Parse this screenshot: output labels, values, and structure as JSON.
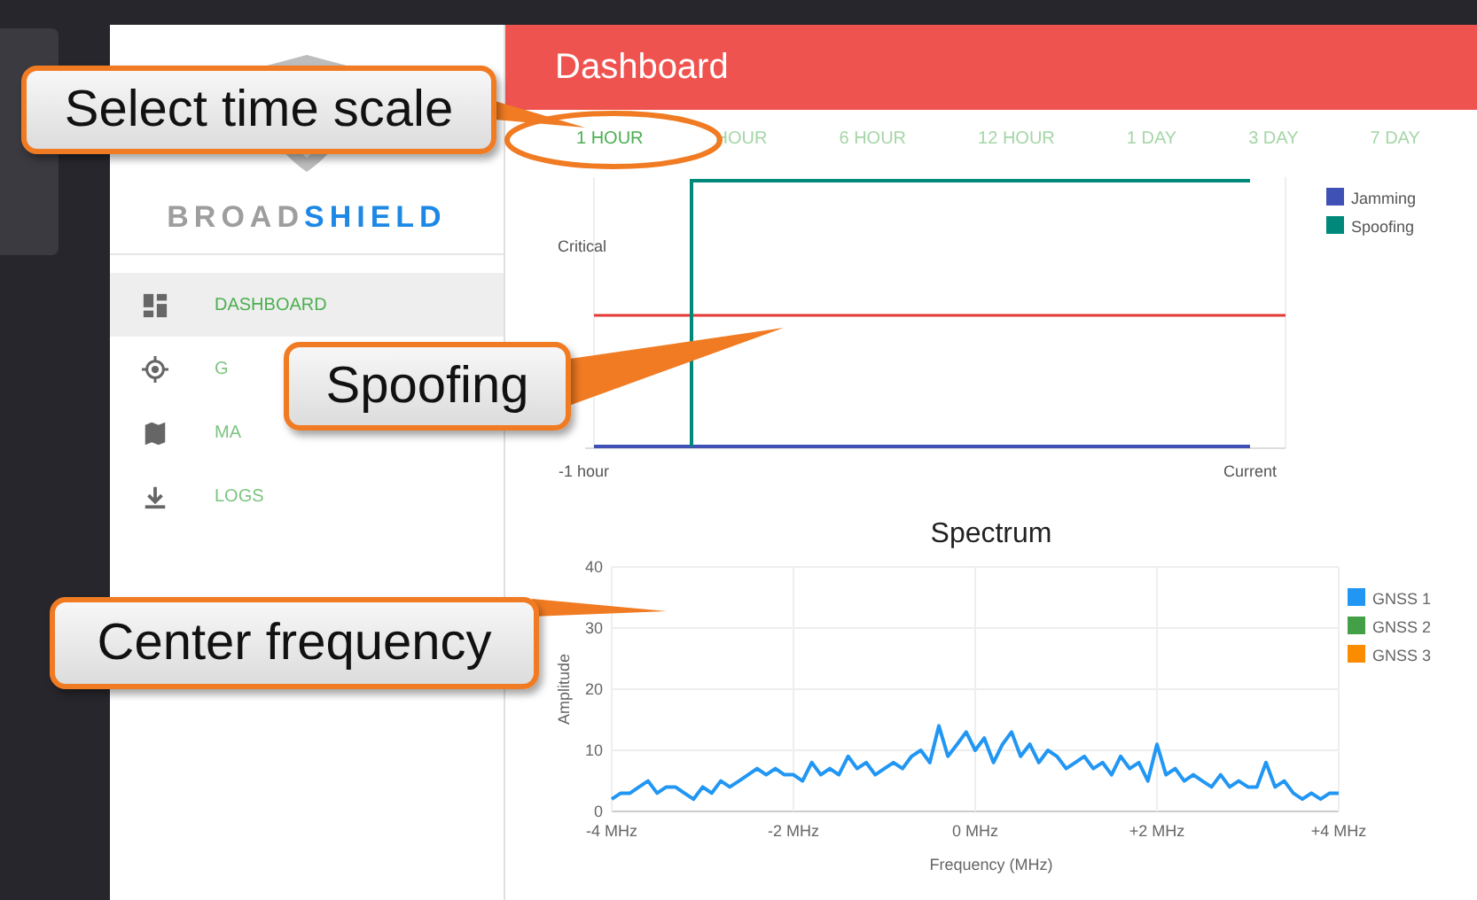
{
  "sidebar": {
    "logo": "BROAD**SHIELD**",
    "items": [
      {
        "kind": "dashboard",
        "label": "DASHBOARD",
        "selected": true
      },
      {
        "kind": "target",
        "label": "G",
        "selected": false
      },
      {
        "kind": "map",
        "label": "MA",
        "selected": false
      },
      {
        "kind": "download",
        "label": "LOGS",
        "selected": false
      }
    ]
  },
  "header": {
    "title": "Dashboard"
  },
  "tabs": [
    {
      "label": "1 HOUR",
      "selected": true
    },
    {
      "label": "HOUR",
      "selected": false
    },
    {
      "label": "6 HOUR",
      "selected": false
    },
    {
      "label": "12 HOUR",
      "selected": false
    },
    {
      "label": "1 DAY",
      "selected": false
    },
    {
      "label": "3 DAY",
      "selected": false
    },
    {
      "label": "7 DAY",
      "selected": false
    }
  ],
  "status_chart": {
    "y_label": "Critical",
    "x_start": "-1 hour",
    "x_end": "Current",
    "legend": [
      {
        "name": "Jamming",
        "color": "#3f51b5"
      },
      {
        "name": "Spoofing",
        "color": "#00897b"
      }
    ]
  },
  "spectrum": {
    "chart_data": {
      "type": "line",
      "grid": true,
      "title": "Spectrum",
      "xlabel": "Frequency (MHz)",
      "ylabel": "Amplitude",
      "xlim": [
        -4,
        4
      ],
      "ylim": [
        0,
        40
      ],
      "xticks": [
        {
          "value": -4,
          "label": "-4 MHz"
        },
        {
          "value": -2,
          "label": "-2 MHz"
        },
        {
          "value": 0,
          "label": "0 MHz"
        },
        {
          "value": 2,
          "label": "+2 MHz"
        },
        {
          "value": 4,
          "label": "+4 MHz"
        }
      ],
      "yticks": [
        0,
        10,
        20,
        30,
        40
      ],
      "x": [
        -4,
        -3.9,
        -3.8,
        -3.7,
        -3.6,
        -3.5,
        -3.4,
        -3.3,
        -3.2,
        -3.1,
        -3,
        -2.9,
        -2.8,
        -2.7,
        -2.6,
        -2.5,
        -2.4,
        -2.3,
        -2.2,
        -2.1,
        -2,
        -1.9,
        -1.8,
        -1.7,
        -1.6,
        -1.5,
        -1.4,
        -1.3,
        -1.2,
        -1.1,
        -1,
        -0.9,
        -0.8,
        -0.7,
        -0.6,
        -0.5,
        -0.4,
        -0.3,
        -0.2,
        -0.1,
        0,
        0.1,
        0.2,
        0.3,
        0.4,
        0.5,
        0.6,
        0.7,
        0.8,
        0.9,
        1,
        1.1,
        1.2,
        1.3,
        1.4,
        1.5,
        1.6,
        1.7,
        1.8,
        1.9,
        2,
        2.1,
        2.2,
        2.3,
        2.4,
        2.5,
        2.6,
        2.7,
        2.8,
        2.9,
        3,
        3.1,
        3.2,
        3.3,
        3.4,
        3.5,
        3.6,
        3.7,
        3.8,
        3.9,
        4
      ],
      "series": [
        {
          "name": "GNSS 1",
          "color": "#2196f3",
          "values": [
            2,
            3,
            3,
            4,
            5,
            3,
            4,
            4,
            3,
            2,
            4,
            3,
            5,
            4,
            5,
            6,
            7,
            6,
            7,
            6,
            6,
            5,
            8,
            6,
            7,
            6,
            9,
            7,
            8,
            6,
            7,
            8,
            7,
            9,
            10,
            8,
            14,
            9,
            11,
            13,
            10,
            12,
            8,
            11,
            13,
            9,
            11,
            8,
            10,
            9,
            7,
            8,
            9,
            7,
            8,
            6,
            9,
            7,
            8,
            5,
            11,
            6,
            7,
            5,
            6,
            5,
            4,
            6,
            4,
            5,
            4,
            4,
            8,
            4,
            5,
            3,
            2,
            3,
            2,
            3,
            3
          ]
        },
        {
          "name": "GNSS 2",
          "color": "#43a047",
          "values": [
            null,
            null,
            null,
            null,
            null,
            null,
            null,
            null,
            null,
            null,
            null,
            null,
            null,
            null,
            null,
            null,
            null,
            null,
            null,
            null,
            null,
            null,
            null,
            null,
            null,
            null,
            null,
            null,
            null,
            null,
            null,
            null,
            null,
            null,
            null,
            null,
            null,
            null,
            null,
            null,
            null,
            null,
            null,
            null,
            null,
            null,
            null,
            null,
            null,
            null,
            null,
            null,
            null,
            null,
            null,
            null,
            null,
            null,
            null,
            null,
            null,
            null,
            null,
            null,
            null,
            null,
            null,
            null,
            null,
            null,
            null,
            null,
            null,
            null,
            null,
            null,
            null,
            null,
            null,
            null,
            null
          ]
        },
        {
          "name": "GNSS 3",
          "color": "#fb8c00",
          "values": [
            null,
            null,
            null,
            null,
            null,
            null,
            null,
            null,
            null,
            null,
            null,
            null,
            null,
            null,
            null,
            null,
            null,
            null,
            null,
            null,
            null,
            null,
            null,
            null,
            null,
            null,
            null,
            null,
            null,
            null,
            null,
            null,
            null,
            null,
            null,
            null,
            null,
            null,
            null,
            null,
            null,
            null,
            null,
            null,
            null,
            null,
            null,
            null,
            null,
            null,
            null,
            null,
            null,
            null,
            null,
            null,
            null,
            null,
            null,
            null,
            null,
            null,
            null,
            null,
            null,
            null,
            null,
            null,
            null,
            null,
            null,
            null,
            null,
            null,
            null,
            null,
            null,
            null,
            null,
            null,
            null
          ]
        }
      ]
    }
  },
  "annotations": [
    {
      "text": "Select time scale"
    },
    {
      "text": "Spoofing"
    },
    {
      "text": "Center frequency"
    }
  ]
}
